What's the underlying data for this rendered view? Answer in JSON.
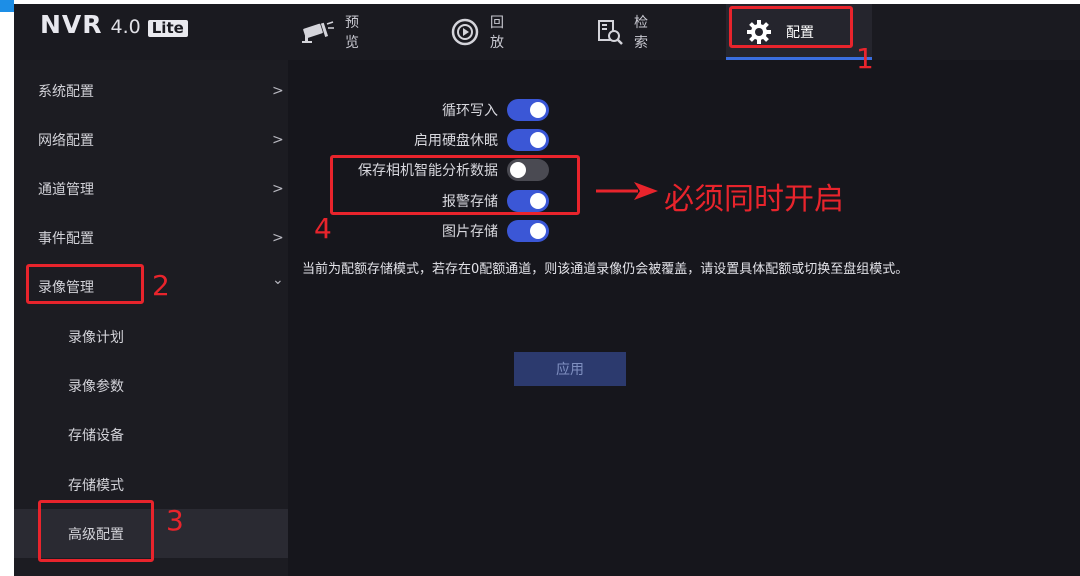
{
  "app": {
    "logo": {
      "brand": "NVR",
      "version": "4.0",
      "edition": "Lite"
    }
  },
  "nav": {
    "tabs": [
      {
        "label": "预览",
        "icon": "camera-icon"
      },
      {
        "label": "回放",
        "icon": "playback-icon"
      },
      {
        "label": "检索",
        "icon": "search-icon"
      },
      {
        "label": "配置",
        "icon": "gear-icon",
        "active": true
      }
    ]
  },
  "sidebar": {
    "items": [
      {
        "label": "系统配置",
        "chevron": ">"
      },
      {
        "label": "网络配置",
        "chevron": ">"
      },
      {
        "label": "通道管理",
        "chevron": ">"
      },
      {
        "label": "事件配置",
        "chevron": ">"
      },
      {
        "label": "录像管理",
        "chevron": "⌄",
        "expanded": true
      },
      {
        "label": "录像计划"
      },
      {
        "label": "录像参数"
      },
      {
        "label": "存储设备"
      },
      {
        "label": "存储模式"
      },
      {
        "label": "高级配置",
        "selected": true
      }
    ]
  },
  "settings": {
    "rows": [
      {
        "label": "循环写入",
        "enabled": true
      },
      {
        "label": "启用硬盘休眠",
        "enabled": true
      },
      {
        "label": "保存相机智能分析数据",
        "enabled": false
      },
      {
        "label": "报警存储",
        "enabled": true
      },
      {
        "label": "图片存储",
        "enabled": true
      }
    ],
    "notice": "当前为配额存储模式，若存在0配额通道，则该通道录像仍会被覆盖，请设置具体配额或切换至盘组模式。",
    "apply_label": "应用"
  },
  "annotations": {
    "step1": "1",
    "step2": "2",
    "step3": "3",
    "step4": "4",
    "callout": "必须同时开启",
    "color": "#e8242c"
  },
  "colors": {
    "accent": "#3b57d6",
    "background": "#16161c",
    "sidebar": "#1c1c22"
  }
}
